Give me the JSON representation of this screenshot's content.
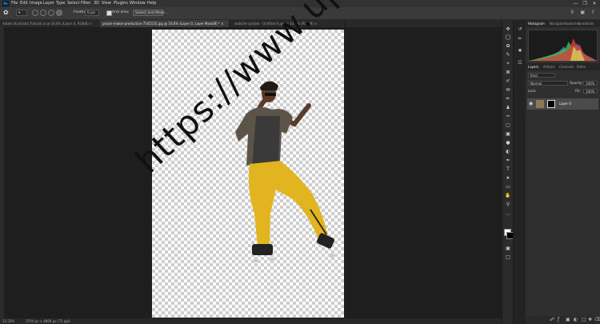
{
  "menubar": {
    "logo": "Ps",
    "items": [
      "File",
      "Edit",
      "Image",
      "Layer",
      "Type",
      "Select",
      "Filter",
      "3D",
      "View",
      "Plugins",
      "Window",
      "Help"
    ],
    "window_controls": [
      "—",
      "❐",
      "✕"
    ]
  },
  "options": {
    "feather_label": "Feather:",
    "feather_value": "0 px",
    "antialias_label": "Anti-alias",
    "select_mask_label": "Select and Mask..."
  },
  "tabs": [
    {
      "label": "Adobe Illustrator Tutorial.ai @ 16.6% (Layer 4, RGB/8) ×",
      "active": false
    },
    {
      "label": "proxin-maker-production-7545155.jpg @ 33.6% (Layer 0, Layer Mask/8) * ×",
      "active": true
    },
    {
      "label": "website-symbol - Untitled-4.jpg @ 33.6% (RGB/8) ×",
      "active": false
    }
  ],
  "watermark": "https://www.uptodays.ir",
  "status": {
    "zoom": "33.33%",
    "size": "3704 px × 4800 px (72 ppi)"
  },
  "panels": {
    "top_tabs": [
      "Histogram",
      "Navigator",
      "Swatches",
      "Gradients"
    ],
    "layer_tabs": [
      "Layers",
      "Actions",
      "Channels",
      "Paths"
    ],
    "kind_label": "Kind",
    "blend_mode": "Normal",
    "opacity_label": "Opacity:",
    "opacity_value": "100%",
    "lock_label": "Lock:",
    "fill_label": "Fill:",
    "fill_value": "100%",
    "layer_name": "Layer 0"
  },
  "colors": {
    "foreground": "#ffffff",
    "background": "#000000",
    "ps_blue": "#31a8ff"
  }
}
